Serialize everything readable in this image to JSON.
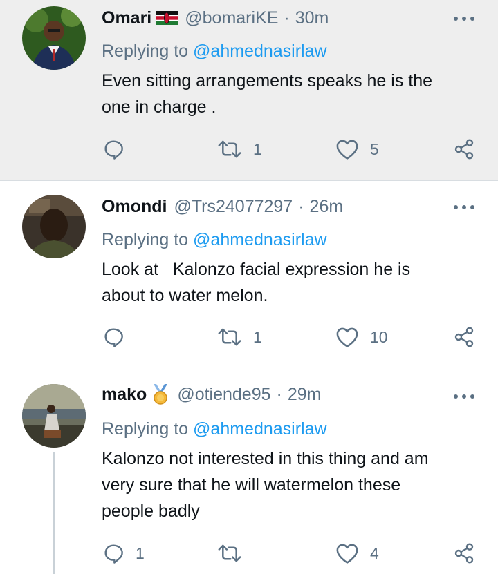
{
  "tweets": [
    {
      "name": "Omari",
      "handle": "@bomariKE",
      "separator": "·",
      "time": "30m",
      "badge_icon": "kenya-flag-icon",
      "replying_prefix": "Replying to",
      "replying_to": "@ahmednasirlaw",
      "text": "Even sitting arrangements speaks he is the\none in charge .",
      "reply_count": "",
      "retweet_count": "1",
      "like_count": "5"
    },
    {
      "name": "Omondi",
      "handle": "@Trs24077297",
      "separator": "·",
      "time": "26m",
      "replying_prefix": "Replying to",
      "replying_to": "@ahmednasirlaw",
      "text": "Look at   Kalonzo facial expression he is\nabout to water melon.",
      "reply_count": "",
      "retweet_count": "1",
      "like_count": "10"
    },
    {
      "name": "mako",
      "handle": "@otiende95",
      "separator": "·",
      "time": "29m",
      "badge_icon": "medal-icon",
      "replying_prefix": "Replying to",
      "replying_to": "@ahmednasirlaw",
      "text": "Kalonzo not interested in this thing and am\nvery sure that he will watermelon these\npeople badly",
      "reply_count": "1",
      "retweet_count": "",
      "like_count": "4"
    }
  ],
  "colors": {
    "highlight_bg": "#eeeeee",
    "link": "#1d9bf0",
    "muted": "#5b7083",
    "text": "#0f1419"
  }
}
